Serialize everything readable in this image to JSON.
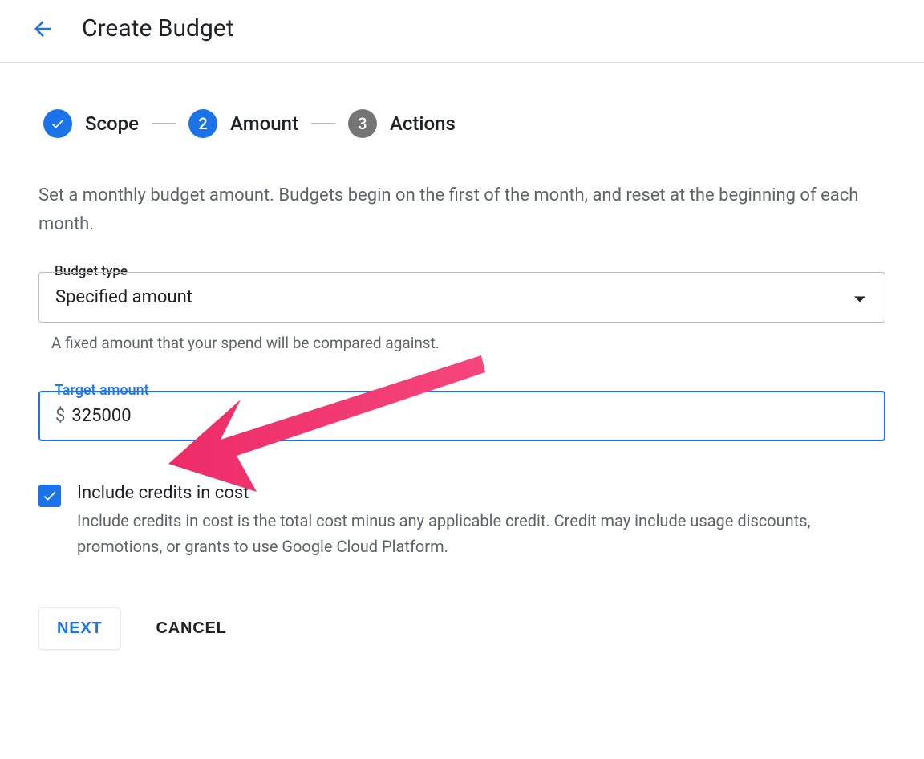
{
  "header": {
    "title": "Create Budget"
  },
  "stepper": {
    "steps": [
      {
        "label": "Scope",
        "num": "✓",
        "state": "done"
      },
      {
        "label": "Amount",
        "num": "2",
        "state": "current"
      },
      {
        "label": "Actions",
        "num": "3",
        "state": "upcoming"
      }
    ]
  },
  "description": "Set a monthly budget amount. Budgets begin on the first of the month, and reset at the beginning of each month.",
  "budgetType": {
    "label": "Budget type",
    "value": "Specified amount",
    "helper": "A fixed amount that your spend will be compared against."
  },
  "targetAmount": {
    "label": "Target amount",
    "currency": "$",
    "value": "325000"
  },
  "includeCredits": {
    "checked": true,
    "title": "Include credits in cost",
    "description": "Include credits in cost is the total cost minus any applicable credit. Credit may include usage discounts, promotions, or grants to use Google Cloud Platform."
  },
  "buttons": {
    "next": "NEXT",
    "cancel": "CANCEL"
  }
}
